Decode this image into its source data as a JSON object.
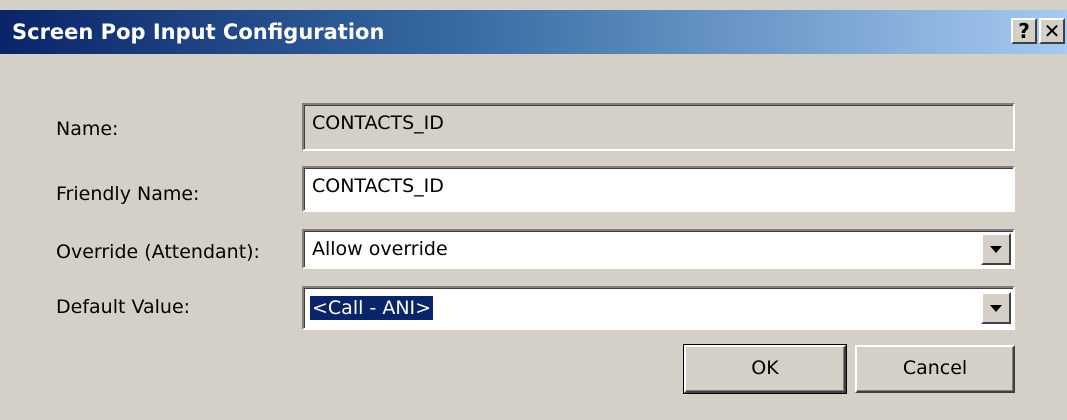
{
  "window": {
    "title": "Screen Pop Input Configuration",
    "help_label": "?",
    "close_label": "✕"
  },
  "form": {
    "name": {
      "label": "Name:",
      "value": "CONTACTS_ID"
    },
    "friendly_name": {
      "label": "Friendly Name:",
      "value": "CONTACTS_ID"
    },
    "override": {
      "label": "Override (Attendant):",
      "value": "Allow override"
    },
    "default_value": {
      "label": "Default Value:",
      "value": "<Call - ANI>"
    }
  },
  "buttons": {
    "ok_label": "OK",
    "cancel_label": "Cancel"
  }
}
